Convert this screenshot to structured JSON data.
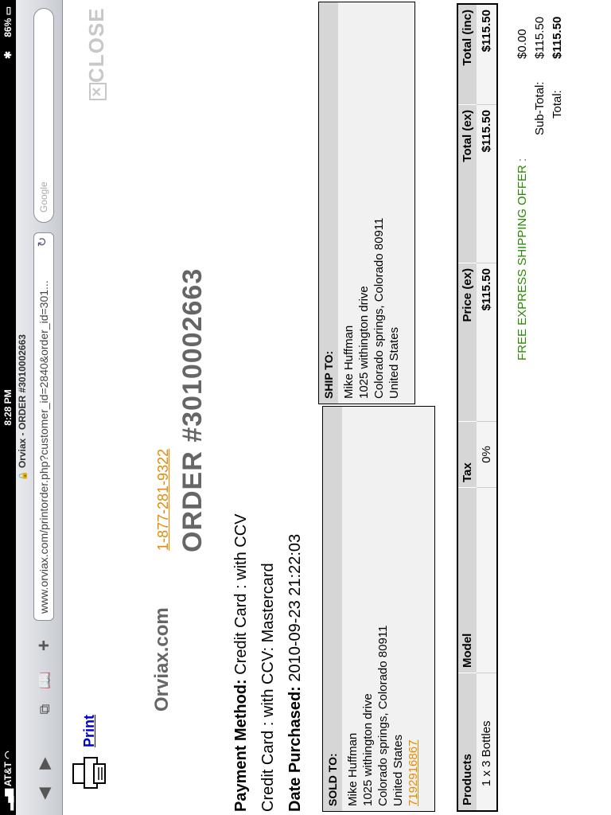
{
  "status_bar": {
    "carrier": "AT&T",
    "time": "8:28 PM",
    "battery": "86%"
  },
  "browser": {
    "tab_title": "Orviax - ORDER #3010002663",
    "url": "www.orviax.com/printorder.php?customer_id=2840&order_id=301...",
    "search_placeholder": "Google"
  },
  "toolbar": {
    "print_label": "Print",
    "close_label": "CLOSE"
  },
  "header": {
    "site_name": "Orviax.com",
    "phone": "1-877-281-9322",
    "order_number": "ORDER #3010002663"
  },
  "payment": {
    "method_label": "Payment Method:",
    "method_value": "Credit Card : with CCV",
    "detail": "Credit Card : with CCV: Mastercard",
    "date_label": "Date Purchased:",
    "date_value": "2010-09-23 21:22:03"
  },
  "sold_to": {
    "title": "SOLD TO:",
    "name": "Mike Huffman",
    "street": "1025 withington drive",
    "city": "Colorado springs, Colorado 80911",
    "country": "United States",
    "phone": "7192916867"
  },
  "ship_to": {
    "title": "SHIP TO:",
    "name": "Mike Huffman",
    "street": "1025 withington drive",
    "city": "Colorado springs, Colorado 80911",
    "country": "United States"
  },
  "products": {
    "headers": [
      "Products",
      "Model",
      "Tax",
      "Price (ex)",
      "Total (ex)",
      "Total (inc)"
    ],
    "rows": [
      {
        "product": "1 x 3 Bottles",
        "model": "",
        "tax": "0%",
        "price_ex": "$115.50",
        "total_ex": "$115.50",
        "total_inc": "$115.50"
      }
    ]
  },
  "totals": {
    "shipping_label": "FREE EXPRESS SHIPPING OFFER :",
    "shipping_value": "$0.00",
    "subtotal_label": "Sub-Total:",
    "subtotal_value": "$115.50",
    "total_label": "Total:",
    "total_value": "$115.50"
  }
}
